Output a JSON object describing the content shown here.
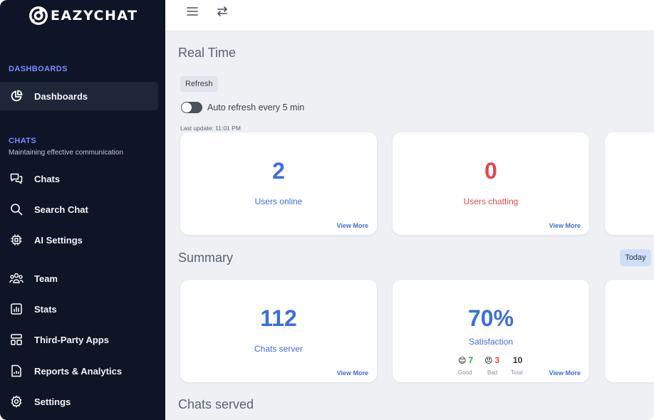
{
  "brand": {
    "name": "EAZYCHAT"
  },
  "sidebar": {
    "sections": [
      {
        "title": "DASHBOARDS"
      },
      {
        "title": "CHATS",
        "subtitle": "Maintaining effective communication"
      }
    ],
    "items": [
      {
        "label": "Dashboards",
        "icon": "pie-chart-icon"
      },
      {
        "label": "Chats",
        "icon": "chat-bubbles-icon"
      },
      {
        "label": "Search Chat",
        "icon": "search-icon"
      },
      {
        "label": "AI Settings",
        "icon": "cpu-chip-icon"
      },
      {
        "label": "Team",
        "icon": "team-icon"
      },
      {
        "label": "Stats",
        "icon": "bar-chart-icon"
      },
      {
        "label": "Third-Party Apps",
        "icon": "apps-icon"
      },
      {
        "label": "Reports & Analytics",
        "icon": "report-icon"
      },
      {
        "label": "Settings",
        "icon": "gear-icon"
      }
    ],
    "active_item": "Dashboards"
  },
  "topbar": {
    "icons": [
      "menu-icon",
      "swap-icon"
    ]
  },
  "realtime": {
    "title": "Real Time",
    "refresh_label": "Refresh",
    "auto_refresh_label": "Auto refresh every 5 min",
    "auto_refresh_on": false,
    "last_update": "Last update: 11:01 PM",
    "cards": [
      {
        "value": "2",
        "caption": "Users online",
        "more": "View More",
        "color": "#3b6fd9"
      },
      {
        "value": "0",
        "caption": "Users chatting",
        "more": "View More",
        "color": "#e04848"
      }
    ]
  },
  "summary": {
    "title": "Summary",
    "range_label": "Today",
    "cards": [
      {
        "value": "112",
        "caption": "Chats server",
        "more": "View More"
      },
      {
        "value": "70%",
        "caption": "Satisfaction",
        "more": "View More",
        "good": {
          "count": "7",
          "label": "Good",
          "emoji": "😊"
        },
        "bad": {
          "count": "3",
          "label": "Bad",
          "emoji": "😠"
        },
        "total": {
          "count": "10",
          "label": "Total"
        }
      }
    ]
  },
  "chats_served": {
    "title": "Chats served"
  },
  "colors": {
    "sidebar_bg": "#0e1527",
    "accent": "#3b6fd9",
    "danger": "#e04848",
    "section": "#7b8cff",
    "good": "#2e9e4f"
  }
}
